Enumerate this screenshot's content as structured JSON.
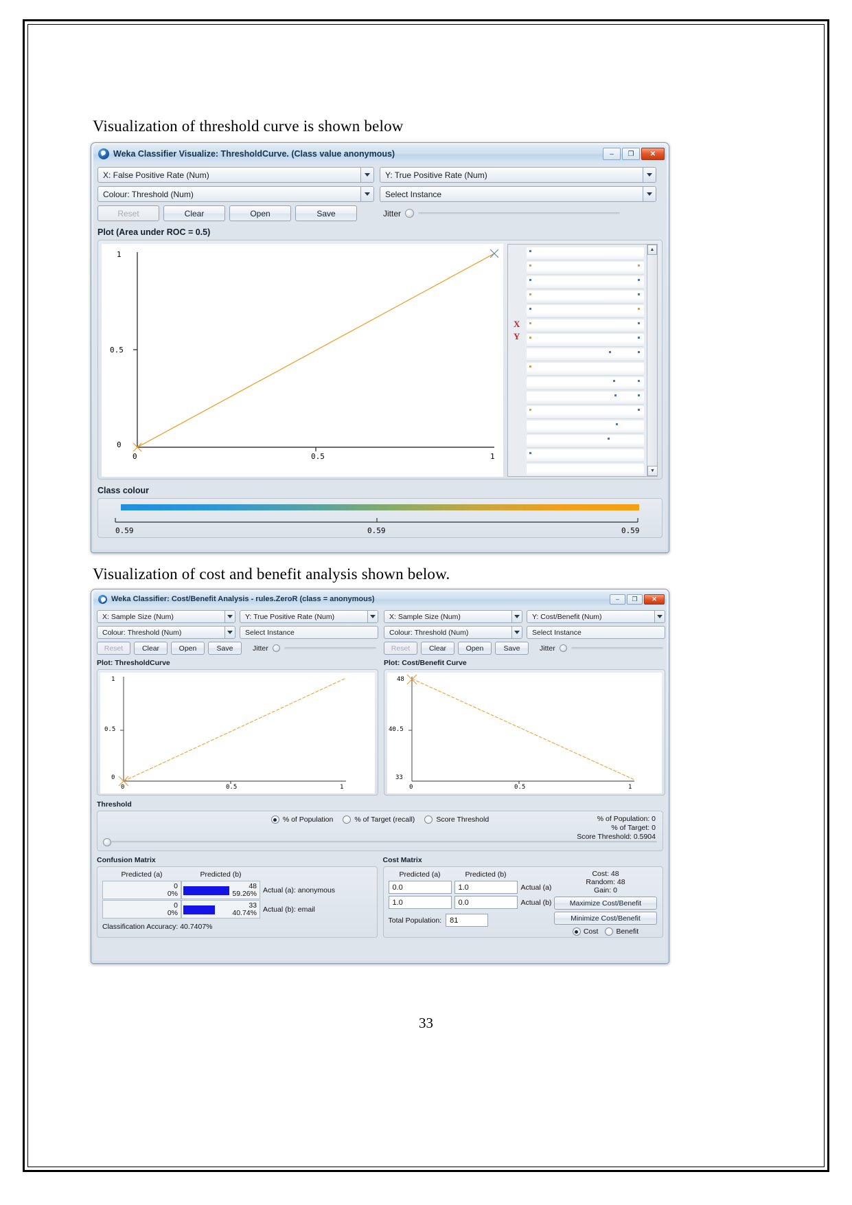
{
  "page": {
    "number": "33",
    "caption_top": "Visualization of threshold curve is shown below",
    "caption_bottom": "Visualization of cost and benefit analysis shown below."
  },
  "threshold_window": {
    "title": "Weka Classifier Visualize: ThresholdCurve. (Class value anonymous)",
    "window_buttons": {
      "minimize": "–",
      "maximize": "❐",
      "close": "✕"
    },
    "selectors": {
      "x_axis": "X: False Positive Rate (Num)",
      "y_axis": "Y: True Positive Rate (Num)",
      "colour": "Colour: Threshold (Num)",
      "select_instance": "Select Instance"
    },
    "buttons": {
      "reset": "Reset",
      "clear": "Clear",
      "open": "Open",
      "save": "Save"
    },
    "jitter_label": "Jitter",
    "plot_group_label": "Plot (Area under ROC = 0.5)",
    "axis": {
      "y_ticks": [
        "1",
        "0.5",
        "0"
      ],
      "x_ticks": [
        "0",
        "0.5",
        "1"
      ]
    },
    "xy_marks": {
      "x": "X",
      "y": "Y"
    },
    "class_colour_label": "Class colour",
    "class_colour_ticks": [
      "0.59",
      "0.59",
      "0.59"
    ],
    "class_colour_gradient": [
      "#1f8fe0",
      "#86ab6a",
      "#f79e12"
    ]
  },
  "cost_window": {
    "title": "Weka Classifier: Cost/Benefit Analysis - rules.ZeroR  (class = anonymous)",
    "window_buttons": {
      "minimize": "–",
      "maximize": "❐",
      "close": "✕"
    },
    "left_panel": {
      "x_axis": "X: Sample Size (Num)",
      "y_axis": "Y: True Positive Rate (Num)",
      "colour": "Colour: Threshold (Num)",
      "select_instance": "Select Instance",
      "buttons": {
        "reset": "Reset",
        "clear": "Clear",
        "open": "Open",
        "save": "Save"
      },
      "jitter_label": "Jitter",
      "plot_label": "Plot: ThresholdCurve",
      "y_ticks": [
        "1",
        "0.5",
        "0"
      ],
      "x_ticks": [
        "0",
        "0.5",
        "1"
      ]
    },
    "right_panel": {
      "x_axis": "X: Sample Size (Num)",
      "y_axis": "Y: Cost/Benefit (Num)",
      "colour": "Colour: Threshold (Num)",
      "select_instance": "Select Instance",
      "buttons": {
        "reset": "Reset",
        "clear": "Clear",
        "open": "Open",
        "save": "Save"
      },
      "jitter_label": "Jitter",
      "plot_label": "Plot: Cost/Benefit Curve",
      "y_ticks": [
        "48",
        "40.5",
        "33"
      ],
      "x_ticks": [
        "0",
        "0.5",
        "1"
      ]
    },
    "threshold": {
      "group_label": "Threshold",
      "options": [
        "% of Population",
        "% of Target (recall)",
        "Score Threshold"
      ],
      "selected_index": 0,
      "readout": [
        "% of Population: 0",
        "% of Target: 0",
        "Score Threshold: 0.5904"
      ]
    },
    "confusion_matrix": {
      "group_label": "Confusion Matrix",
      "col_headers": [
        "Predicted (a)",
        "Predicted (b)"
      ],
      "rows": [
        {
          "count_a": "0",
          "pct_a": "0%",
          "count_b": "48",
          "pct_b": "59.26%",
          "actual": "Actual (a): anonymous",
          "bar_pct": 59
        },
        {
          "count_a": "0",
          "pct_a": "0%",
          "count_b": "33",
          "pct_b": "40.74%",
          "actual": "Actual (b): email",
          "bar_pct": 41
        }
      ],
      "accuracy": "Classification Accuracy:  40.7407%"
    },
    "cost_matrix": {
      "group_label": "Cost Matrix",
      "col_headers": [
        "Predicted (a)",
        "Predicted (b)"
      ],
      "rows": [
        {
          "v1": "0.0",
          "v2": "1.0",
          "actual": "Actual (a)"
        },
        {
          "v1": "1.0",
          "v2": "0.0",
          "actual": "Actual (b)"
        }
      ],
      "total_population_label": "Total Population:",
      "total_population_value": "81",
      "stats": [
        "Cost: 48",
        "Random: 48",
        "Gain: 0"
      ],
      "buttons": {
        "maximize": "Maximize Cost/Benefit",
        "minimize": "Minimize Cost/Benefit"
      },
      "mode_options": [
        "Cost",
        "Benefit"
      ],
      "mode_selected_index": 0
    }
  },
  "chart_data": [
    {
      "type": "line",
      "title": "Plot (Area under ROC = 0.5)",
      "xlabel": "False Positive Rate",
      "ylabel": "True Positive Rate",
      "x": [
        0,
        1
      ],
      "values": [
        0,
        1
      ],
      "xlim": [
        0,
        1
      ],
      "ylim": [
        0,
        1
      ],
      "xticks": [
        "0",
        "0.5",
        "1"
      ],
      "yticks": [
        "0",
        "0.5",
        "1"
      ],
      "series_color": "#f0a132",
      "grid": false,
      "legend": "none"
    },
    {
      "type": "line",
      "title": "Plot: ThresholdCurve",
      "xlabel": "Sample Size",
      "ylabel": "True Positive Rate",
      "x": [
        0,
        1
      ],
      "values": [
        0,
        1
      ],
      "xlim": [
        0,
        1
      ],
      "ylim": [
        0,
        1
      ],
      "xticks": [
        "0",
        "0.5",
        "1"
      ],
      "yticks": [
        "0",
        "0.5",
        "1"
      ],
      "series_color": "#f0a132",
      "grid": false,
      "legend": "none"
    },
    {
      "type": "line",
      "title": "Plot: Cost/Benefit Curve",
      "xlabel": "Sample Size",
      "ylabel": "Cost/Benefit",
      "x": [
        0,
        1
      ],
      "values": [
        48,
        33
      ],
      "xlim": [
        0,
        1
      ],
      "ylim": [
        33,
        48
      ],
      "xticks": [
        "0",
        "0.5",
        "1"
      ],
      "yticks": [
        "33",
        "40.5",
        "48"
      ],
      "series_color": "#f0a132",
      "grid": false,
      "legend": "none"
    }
  ]
}
